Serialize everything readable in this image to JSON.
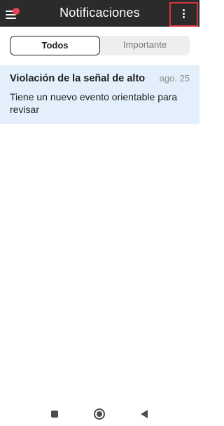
{
  "header": {
    "title": "Notificaciones",
    "menu_icon": "hamburger-menu-icon",
    "badge_color": "#e6434f",
    "more_icon": "more-vertical-icon",
    "highlight_color": "#d9343a"
  },
  "tabs": [
    {
      "label": "Todos",
      "selected": true
    },
    {
      "label": "Importante",
      "selected": false
    }
  ],
  "notifications": [
    {
      "title": "Violación de la señal de alto",
      "date": "ago. 25",
      "body": "Tiene un nuevo evento orientable para revisar",
      "background": "#e3f0fb"
    }
  ],
  "system_nav": {
    "recents_icon": "square-recents-icon",
    "home_icon": "circle-home-icon",
    "back_icon": "triangle-back-icon"
  }
}
